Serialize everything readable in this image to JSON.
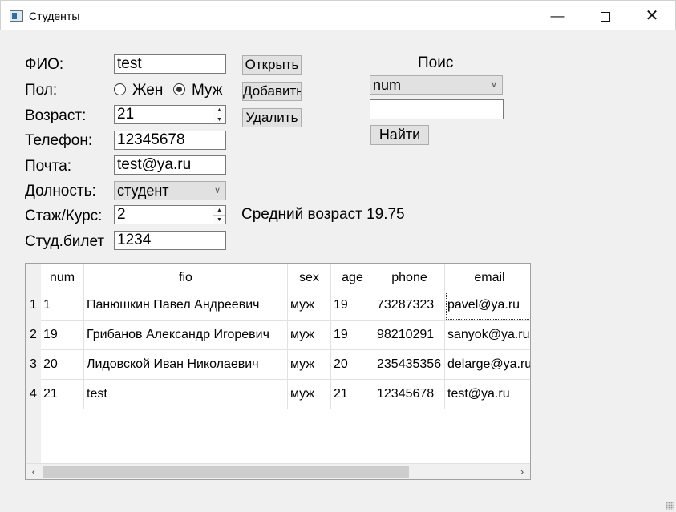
{
  "window": {
    "title": "Студенты",
    "min_label": "—",
    "close_label": "✕"
  },
  "form": {
    "fio_label": "ФИО:",
    "fio_value": "test",
    "sex_label": "Пол:",
    "sex_female": "Жен",
    "sex_male": "Муж",
    "sex_selected": "Муж",
    "age_label": "Возраст:",
    "age_value": "21",
    "phone_label": "Телефон:",
    "phone_value": "12345678",
    "email_label": "Почта:",
    "email_value": "test@ya.ru",
    "position_label": "Долность:",
    "position_value": "студент",
    "course_label": "Стаж/Курс:",
    "course_value": "2",
    "ticket_label": "Студ.билет",
    "ticket_value": "1234"
  },
  "buttons": {
    "open": "Открыть",
    "add": "Добавить",
    "delete": "Удалить"
  },
  "search": {
    "title": "Поис",
    "field_value": "num",
    "query": "",
    "find": "Найти"
  },
  "average_age": "Средний возраст 19.75",
  "table": {
    "columns": [
      "num",
      "fio",
      "sex",
      "age",
      "phone",
      "email"
    ],
    "rows": [
      {
        "row_number": "1",
        "num": "1",
        "fio": "Панюшкин Павел Андреевич",
        "sex": "муж",
        "age": "19",
        "phone": "73287323",
        "email": "pavel@ya.ru"
      },
      {
        "row_number": "2",
        "num": "19",
        "fio": "Грибанов Александр Игоревич",
        "sex": "муж",
        "age": "19",
        "phone": "98210291",
        "email": "sanyok@ya.ru"
      },
      {
        "row_number": "3",
        "num": "20",
        "fio": "Лидовской Иван Николаевич",
        "sex": "муж",
        "age": "20",
        "phone": "235435356",
        "email": "delarge@ya.ru"
      },
      {
        "row_number": "4",
        "num": "21",
        "fio": "test",
        "sex": "муж",
        "age": "21",
        "phone": "12345678",
        "email": "test@ya.ru"
      }
    ]
  }
}
